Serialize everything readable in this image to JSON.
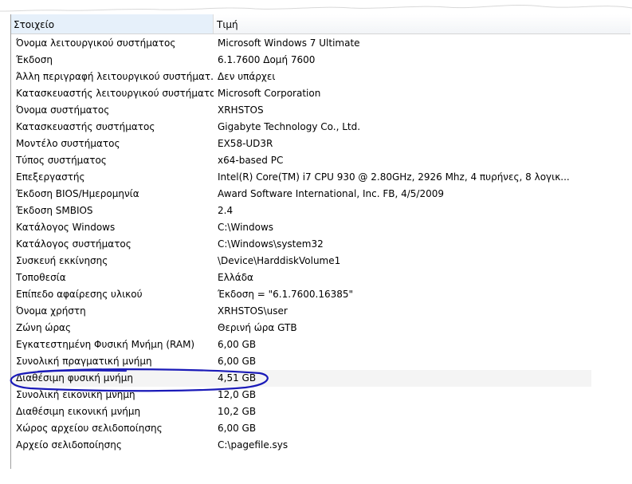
{
  "header": {
    "item_label": "Στοιχείο",
    "value_label": "Τιμή"
  },
  "rows": [
    {
      "item": "Όνομα λειτουργικού συστήματος",
      "value": "Microsoft Windows 7 Ultimate"
    },
    {
      "item": "Έκδοση",
      "value": "6.1.7600 Δομή 7600"
    },
    {
      "item": "Άλλη περιγραφή λειτουργικού συστήματ...",
      "value": "Δεν υπάρχει"
    },
    {
      "item": "Κατασκευαστής λειτουργικού συστήματος",
      "value": "Microsoft Corporation"
    },
    {
      "item": "Όνομα συστήματος",
      "value": "XRHSTOS"
    },
    {
      "item": "Κατασκευαστής συστήματος",
      "value": "Gigabyte Technology Co., Ltd."
    },
    {
      "item": "Μοντέλο συστήματος",
      "value": "EX58-UD3R"
    },
    {
      "item": "Τύπος συστήματος",
      "value": "x64-based PC"
    },
    {
      "item": "Επεξεργαστής",
      "value": "Intel(R) Core(TM) i7 CPU         930  @ 2.80GHz, 2926 Mhz, 4 πυρήνες, 8 λογικ..."
    },
    {
      "item": "Έκδοση BIOS/Ημερομηνία",
      "value": "Award Software International, Inc. FB, 4/5/2009"
    },
    {
      "item": "Έκδοση SMBIOS",
      "value": "2.4"
    },
    {
      "item": "Κατάλογος Windows",
      "value": "C:\\Windows"
    },
    {
      "item": "Κατάλογος συστήματος",
      "value": "C:\\Windows\\system32"
    },
    {
      "item": "Συσκευή εκκίνησης",
      "value": "\\Device\\HarddiskVolume1"
    },
    {
      "item": "Τοποθεσία",
      "value": "Ελλάδα"
    },
    {
      "item": "Επίπεδο αφαίρεσης υλικού",
      "value": "Έκδοση = \"6.1.7600.16385\""
    },
    {
      "item": "Όνομα χρήστη",
      "value": "XRHSTOS\\user"
    },
    {
      "item": "Ζώνη ώρας",
      "value": "Θερινή ώρα GTB"
    },
    {
      "item": "Εγκατεστημένη Φυσική Μνήμη (RAM)",
      "value": "6,00 GB"
    },
    {
      "item": "Συνολική πραγματική μνήμη",
      "value": "6,00 GB"
    },
    {
      "item": "Διαθέσιμη φυσική μνήμη",
      "value": "4,51 GB"
    },
    {
      "item": "Συνολική εικονική μνήμη",
      "value": "12,0 GB"
    },
    {
      "item": "Διαθέσιμη εικονική μνήμη",
      "value": "10,2 GB"
    },
    {
      "item": "Χώρος αρχείου σελιδοποίησης",
      "value": "6,00 GB"
    },
    {
      "item": "Αρχείο σελιδοποίησης",
      "value": "C:\\pagefile.sys"
    }
  ],
  "highlight_row_index": 20,
  "colors": {
    "marker": "#1a1ab8",
    "header_selected": "#e6f0fa"
  }
}
